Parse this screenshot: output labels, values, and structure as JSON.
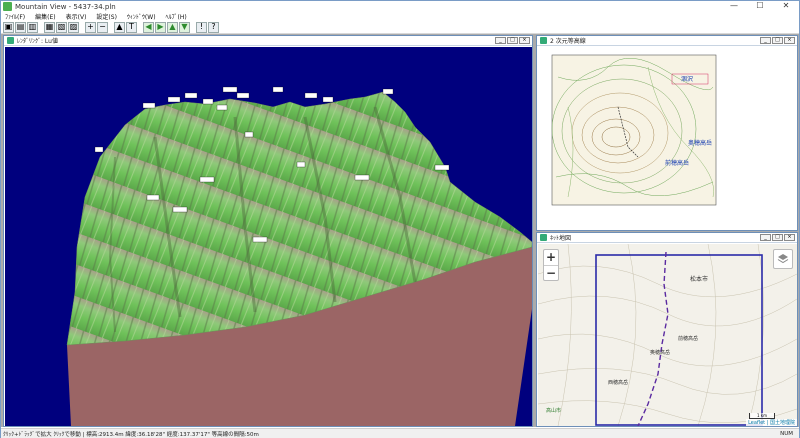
{
  "window": {
    "title": "Mountain View - 5437-34.pln",
    "minimize": "—",
    "maximize": "☐",
    "close": "✕"
  },
  "menu": [
    "ﾌｧｲﾙ(F)",
    "編集(E)",
    "表示(V)",
    "設定(S)",
    "ｳｨﾝﾄﾞｳ(W)",
    "ﾍﾙﾌﾟ(H)"
  ],
  "toolbar": {
    "buttons": [
      {
        "name": "open-icon",
        "glyph": "▣"
      },
      {
        "name": "save-icon",
        "glyph": "▤"
      },
      {
        "name": "load-icon",
        "glyph": "▥"
      },
      {
        "name": "print-icon",
        "glyph": "▦"
      },
      {
        "name": "map-icon",
        "glyph": "▧"
      },
      {
        "name": "grid-icon",
        "glyph": "▨"
      },
      {
        "name": "zoom-in-icon",
        "glyph": "+"
      },
      {
        "name": "zoom-out-icon",
        "glyph": "−"
      },
      {
        "name": "landscape-icon",
        "glyph": "▲"
      },
      {
        "name": "text-icon",
        "glyph": "T"
      },
      {
        "name": "arrow-left-icon",
        "glyph": "◀"
      },
      {
        "name": "arrow-right-icon",
        "glyph": "▶"
      },
      {
        "name": "arrow-up-icon",
        "glyph": "▲"
      },
      {
        "name": "arrow-down-icon",
        "glyph": "▼"
      },
      {
        "name": "pin-icon",
        "glyph": "!"
      },
      {
        "name": "help-icon",
        "glyph": "?"
      }
    ]
  },
  "render_window": {
    "title": "ﾚﾝﾀﾞﾘﾝｸﾞ: Lu値"
  },
  "topo_window": {
    "title": "2 次元等高線",
    "labels": [
      {
        "text": "涸沢",
        "color": "#1a3fb0"
      },
      {
        "text": "奥穂高岳",
        "color": "#1a3fb0"
      },
      {
        "text": "前穂高岳",
        "color": "#1a3fb0"
      }
    ]
  },
  "web_window": {
    "title": "ﾈｯﾄ地図",
    "zoom_in": "+",
    "zoom_out": "−",
    "attribution": "Leaflet | 国土地理院",
    "scale": "1 km",
    "labels": [
      "松本市",
      "前穂高岳",
      "奥穂高岳",
      "西穂高岳",
      "高山市"
    ]
  },
  "status": {
    "text": "ｸﾘｯｸ+ﾄﾞﾗｯｸﾞで拡大 ｸﾘｯｸで移動 | 標高:2913.4m 緯度:36.18'28\" 経度:137.37'17\" 等高線の間隔:50m",
    "numlock": "NUM"
  }
}
